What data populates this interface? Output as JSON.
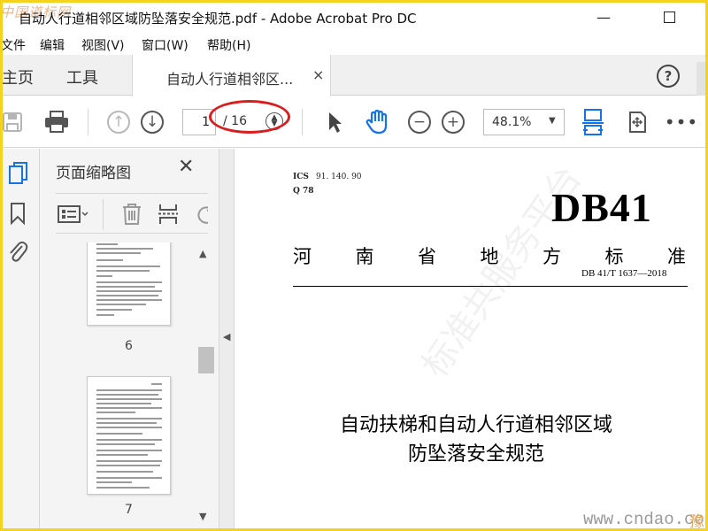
{
  "window": {
    "title": "自动人行道相邻区域防坠落安全规范.pdf - Adobe Acrobat Pro DC",
    "watermark_top": "中国道标网"
  },
  "menu": {
    "items": [
      "文件",
      "编辑",
      "视图(V)",
      "窗口(W)",
      "帮助(H)"
    ]
  },
  "tabs": {
    "home": "主页",
    "tools": "工具",
    "document": "自动人行道相邻区...",
    "close": "×",
    "help": "?"
  },
  "toolbar": {
    "current_page": "1",
    "total_pages": "/ 16",
    "zoom": "48.1%"
  },
  "panel": {
    "title": "页面缩略图",
    "thumbnails": [
      {
        "page": "6"
      },
      {
        "page": "7"
      }
    ]
  },
  "document": {
    "ics_label": "ICS",
    "ics_value": "91. 140. 90",
    "q_label": "Q 78",
    "db_code": "DB41",
    "standard_title_chars": [
      "河",
      "南",
      "省",
      "地",
      "方",
      "标",
      "准"
    ],
    "standard_number": "DB 41/T 1637—2018",
    "title_line1": "自动扶梯和自动人行道相邻区域",
    "title_line2": "防坠落安全规范",
    "diagonal_watermark": "标准共服务平台"
  },
  "overlay": {
    "site_watermark": "www.cndao.com",
    "corner_mark": "豫"
  },
  "colors": {
    "frame_border": "#f5d21e",
    "annotation_red": "#d81e1e",
    "active_blue": "#1473e6"
  }
}
